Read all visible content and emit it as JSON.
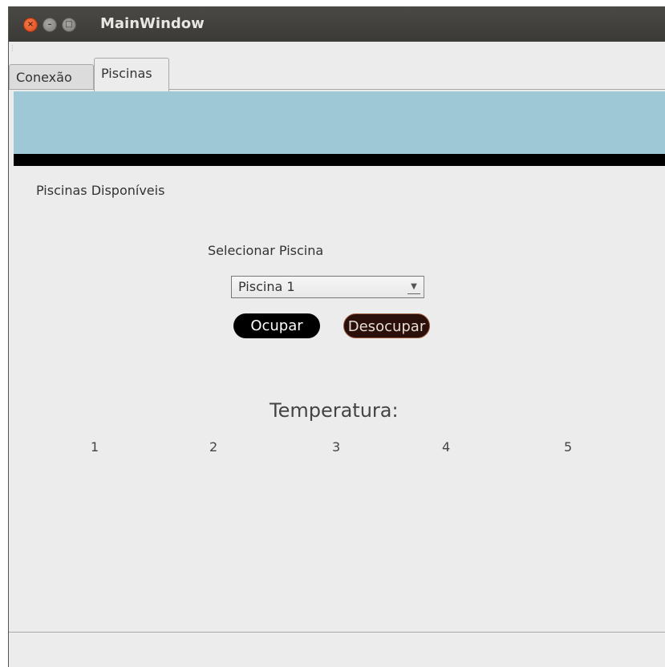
{
  "window": {
    "title": "MainWindow",
    "controls": {
      "close": "close-icon",
      "minimize": "minimize-icon",
      "maximize": "maximize-icon"
    }
  },
  "tabs": [
    {
      "label": "Conexão",
      "active": false
    },
    {
      "label": "Piscinas",
      "active": true
    }
  ],
  "banner": {
    "color": "#9fc8d6",
    "bar_color": "#000000"
  },
  "pools": {
    "available_label": "Piscinas Disponíveis",
    "select_label": "Selecionar Piscina",
    "selected": "Piscina 1",
    "occupy_button": "Ocupar",
    "vacate_button": "Desocupar"
  },
  "temperature": {
    "label": "Temperatura:",
    "values": [
      "1",
      "2",
      "3",
      "4",
      "5"
    ]
  }
}
